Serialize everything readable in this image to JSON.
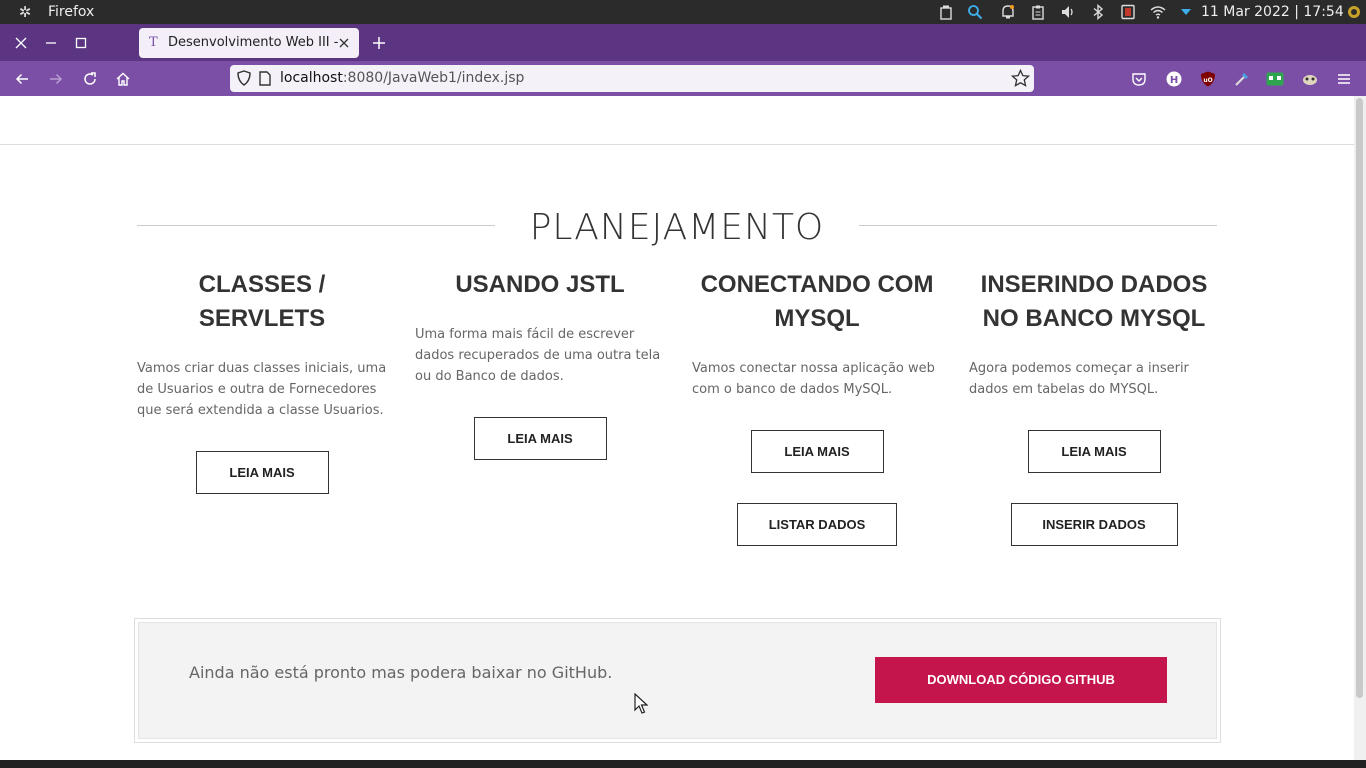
{
  "system_panel": {
    "app_name": "Firefox",
    "clock": "11 Mar 2022 | 17:54"
  },
  "browser": {
    "tab_title": "Desenvolvimento Web III - H",
    "url_host": "localhost",
    "url_rest": ":8080/JavaWeb1/index.jsp"
  },
  "page": {
    "section_title": "PLANEJAMENTO",
    "columns": [
      {
        "title": "CLASSES / SERVLETS",
        "text": "Vamos criar duas classes iniciais, uma de Usuarios e outra de Fornecedores que será extendida a classe Usuarios.",
        "buttons": [
          "LEIA MAIS"
        ]
      },
      {
        "title": "USANDO JSTL",
        "text": "Uma forma mais fácil de escrever dados recuperados de uma outra tela ou do Banco de dados.",
        "buttons": [
          "LEIA MAIS"
        ]
      },
      {
        "title": "CONECTANDO COM MYSQL",
        "text": "Vamos conectar nossa aplicação web com o banco de dados MySQL.",
        "buttons": [
          "LEIA MAIS",
          "LISTAR DADOS"
        ]
      },
      {
        "title": "INSERINDO DADOS NO BANCO MYSQL",
        "text": "Agora podemos começar a inserir dados em tabelas do MYSQL.",
        "buttons": [
          "LEIA MAIS",
          "INSERIR DADOS"
        ]
      }
    ],
    "cta": {
      "text": "Ainda não está pronto mas podera baixar no GitHub.",
      "button": "DOWNLOAD CÓDIGO GITHUB"
    }
  },
  "colors": {
    "tab_bar": "#5b3581",
    "nav_bar": "#7b4fa6",
    "cta_button": "#c4154c"
  }
}
